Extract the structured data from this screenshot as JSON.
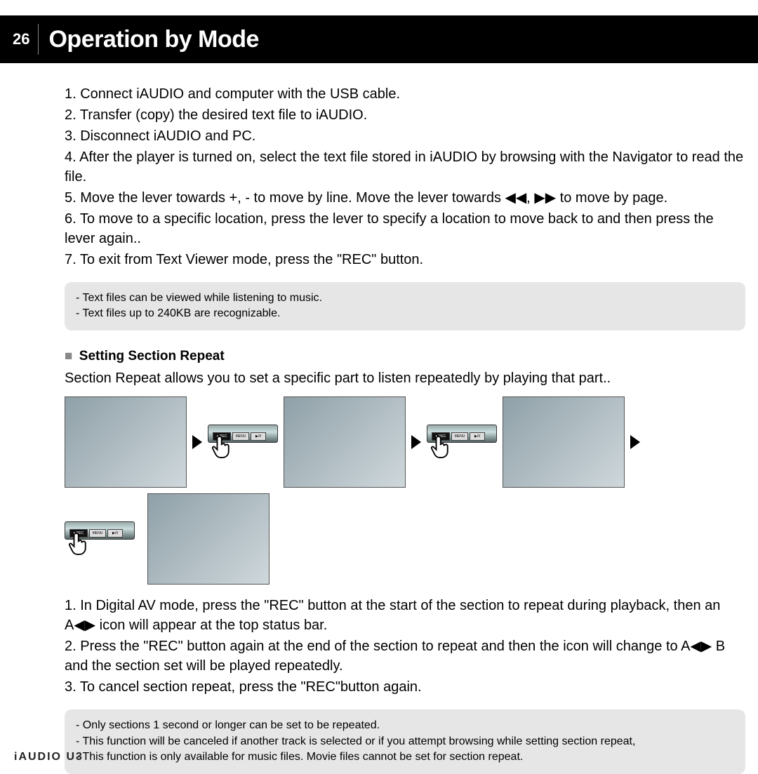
{
  "page_number": "26",
  "title": "Operation by Mode",
  "steps_top": [
    "1. Connect iAUDIO and computer with the USB cable.",
    "2. Transfer (copy) the desired text file to iAUDIO.",
    "3. Disconnect iAUDIO and PC.",
    "4. After the player is turned on, select the text file stored in iAUDIO by browsing with the Navigator to read the file.",
    "5. Move the lever towards +, - to move by line. Move the lever towards ◀◀, ▶▶ to move by page.",
    "6. To move to a specific location, press the lever to specify a location to move back to and then press the lever again..",
    "7. To exit from Text Viewer mode, press the \"REC\" button."
  ],
  "note_top": [
    "- Text files can be viewed while listening to music.",
    "- Text files up to 240KB are recognizable."
  ],
  "section_title": "Setting Section Repeat",
  "section_desc": "Section Repeat allows you to set a specific part to listen repeatedly by playing that part..",
  "device_labels": {
    "rec": "● REC",
    "menu": "MENU",
    "play": "▶/II"
  },
  "steps_bottom": [
    "1. In Digital AV mode, press the \"REC\" button at the start of the section to repeat during playback, then an A◀▶ icon will appear at the top status bar.",
    "2. Press the \"REC\" button again at the end of the section to repeat and then the icon will change to A◀▶ B and the section set will be played repeatedly.",
    "3. To cancel section repeat, press the \"REC\"button again."
  ],
  "note_bottom": [
    "- Only sections 1 second or longer can be set to be repeated.",
    "- This function will be canceled if another track is selected or if you attempt browsing while setting section repeat,",
    "- This function is only available for music files. Movie files cannot be set for section repeat."
  ],
  "footer": "iAUDIO U3"
}
